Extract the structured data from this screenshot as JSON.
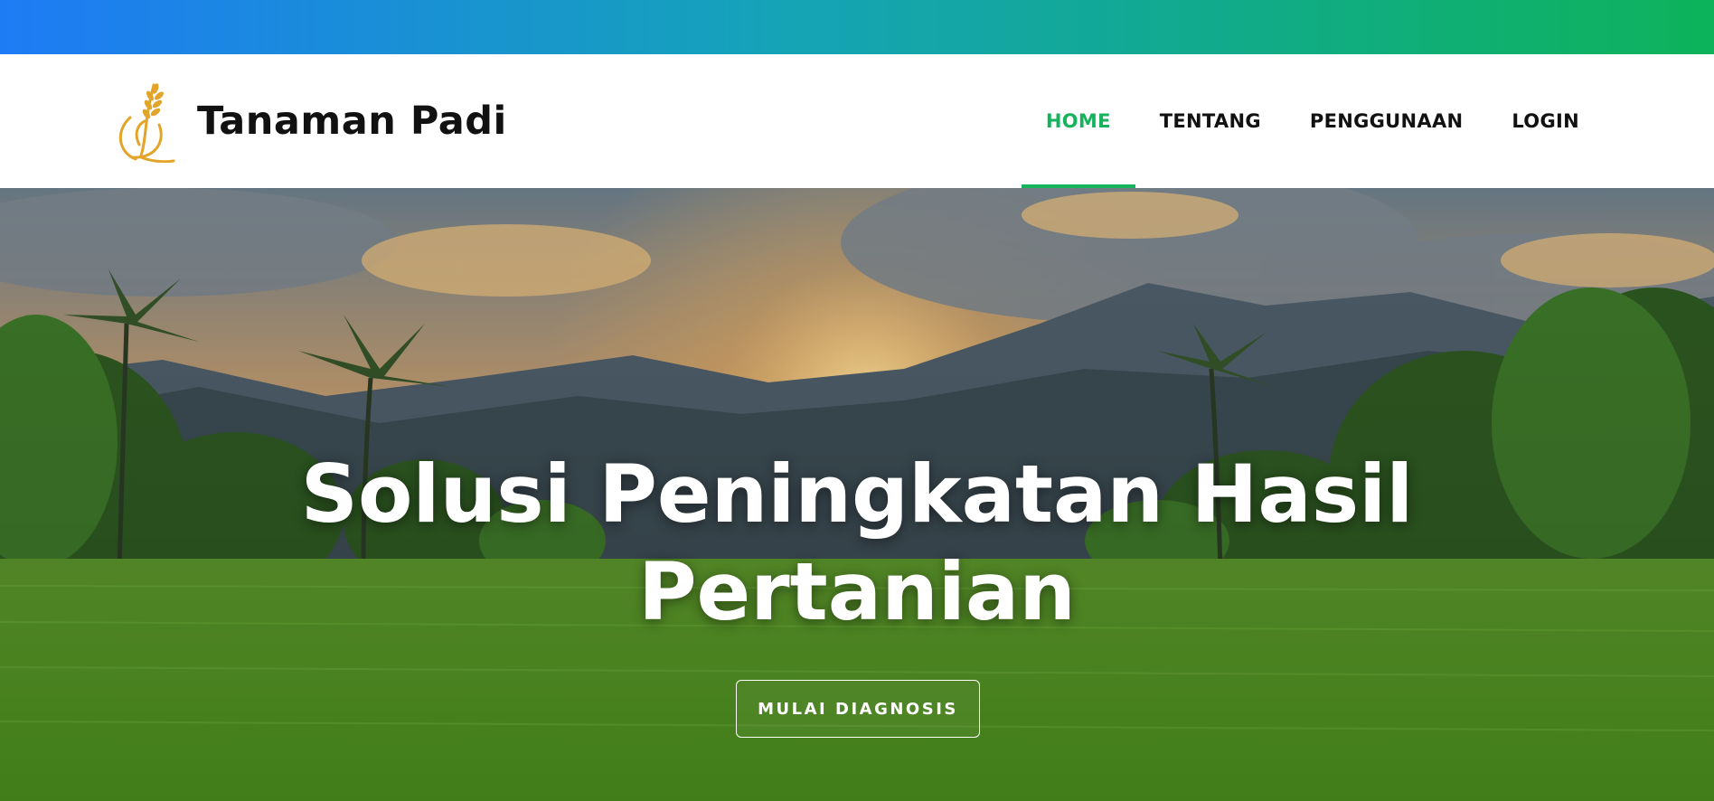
{
  "brand": {
    "name": "Tanaman Padi",
    "logo_icon": "rice-plant-icon",
    "logo_color": "#e2a52a"
  },
  "nav": {
    "items": [
      {
        "label": "HOME",
        "active": true
      },
      {
        "label": "TENTANG",
        "active": false
      },
      {
        "label": "PENGGUNAAN",
        "active": false
      },
      {
        "label": "LOGIN",
        "active": false
      }
    ]
  },
  "hero": {
    "title_line1": "Solusi Peningkatan Hasil",
    "title_line2": "Pertanian",
    "cta_label": "MULAI DIAGNOSIS"
  },
  "colors": {
    "accent": "#16b35c",
    "gradient_start": "#1e7bf5",
    "gradient_end": "#0db35a",
    "text": "#111111"
  }
}
